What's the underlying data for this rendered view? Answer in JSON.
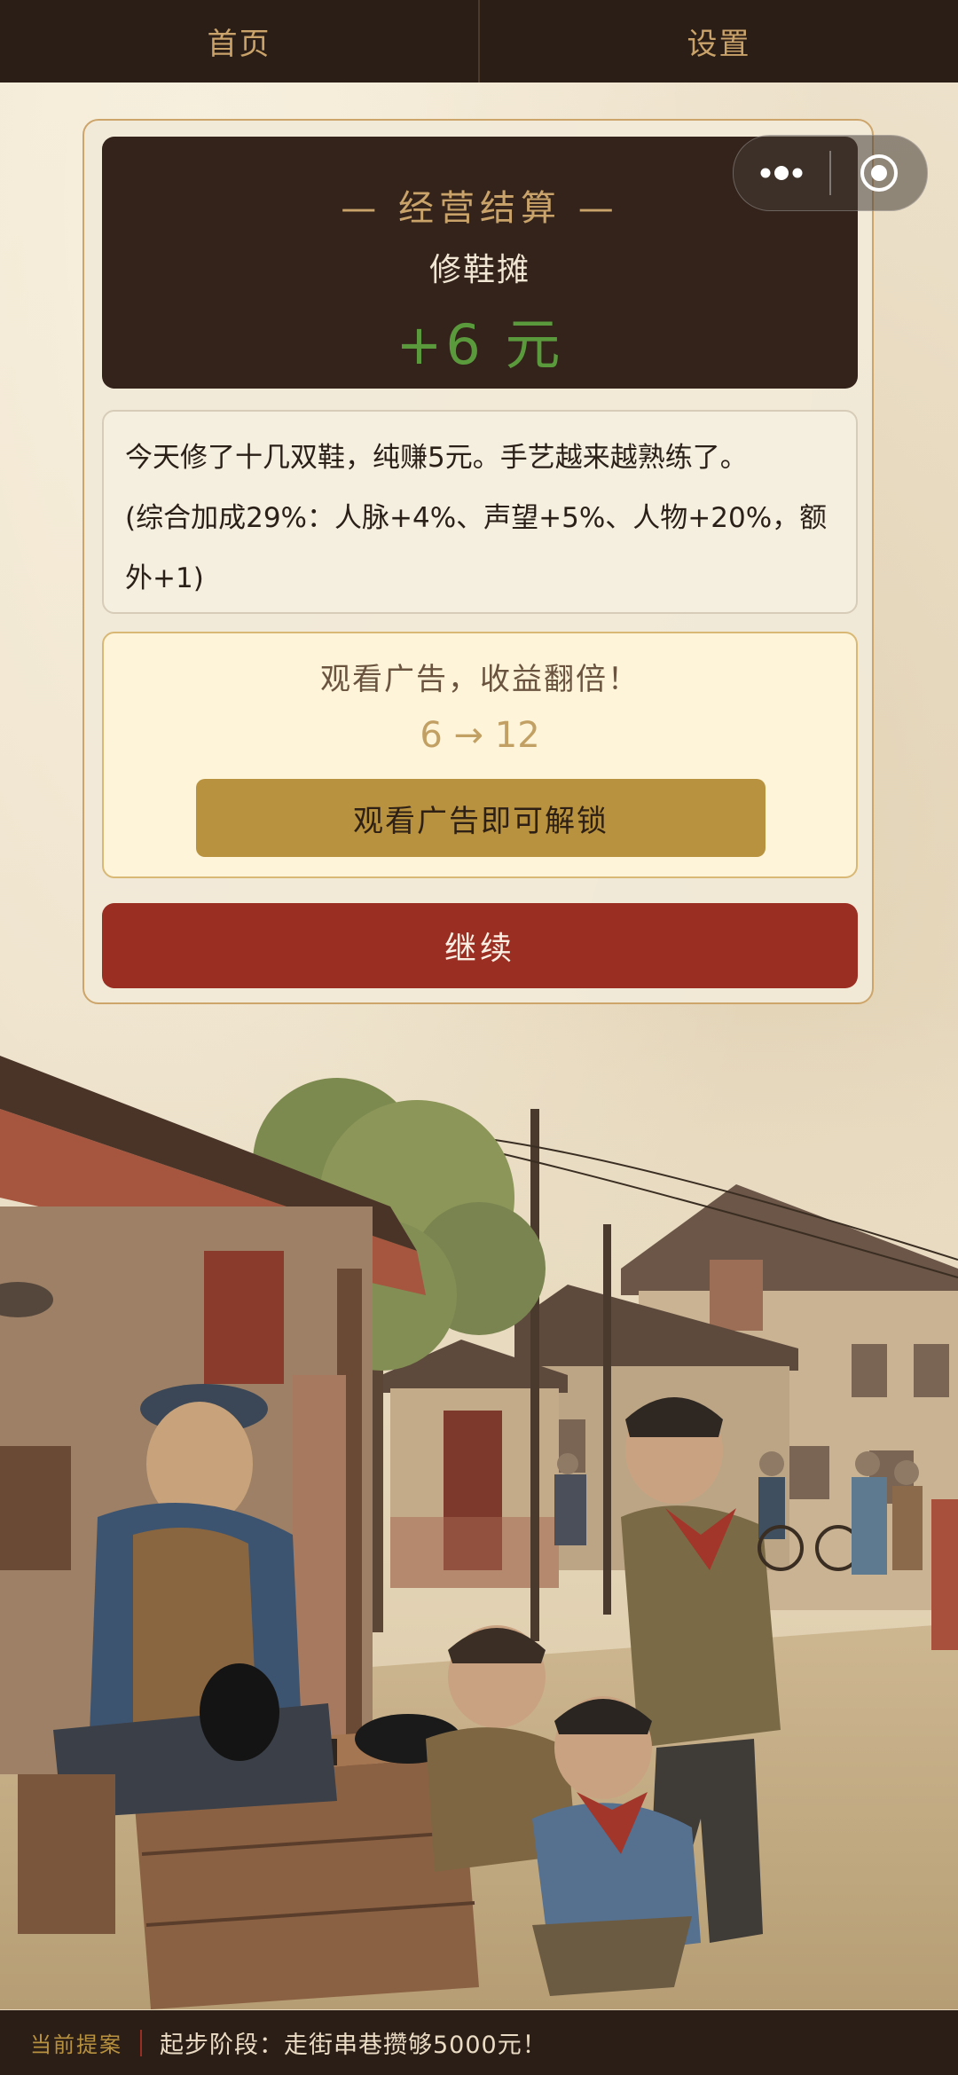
{
  "nav": {
    "tabs": [
      {
        "label": "首页"
      },
      {
        "label": "设置"
      }
    ]
  },
  "capsule": {
    "more_icon": "more-dots-icon",
    "close_icon": "target-close-icon"
  },
  "settlement": {
    "title": "— 经营结算 —",
    "stall_name": "修鞋摊",
    "income": "+6 元",
    "income_color": "#5a9a3c",
    "story_line1": "今天修了十几双鞋，纯赚5元。手艺越来越熟练了。",
    "story_line2": "(综合加成29%：人脉+4%、声望+5%、人物+20%，额外+1)"
  },
  "ad_offer": {
    "title": "观看广告，收益翻倍！",
    "ratio": "6 → 12",
    "button_label": "观看广告即可解锁",
    "button_color": "#b8923f"
  },
  "continue_button": {
    "label": "继续",
    "color": "#9a2e22"
  },
  "footer": {
    "label": "当前提案",
    "text": "起步阶段：走街串巷攒够5000元！"
  }
}
